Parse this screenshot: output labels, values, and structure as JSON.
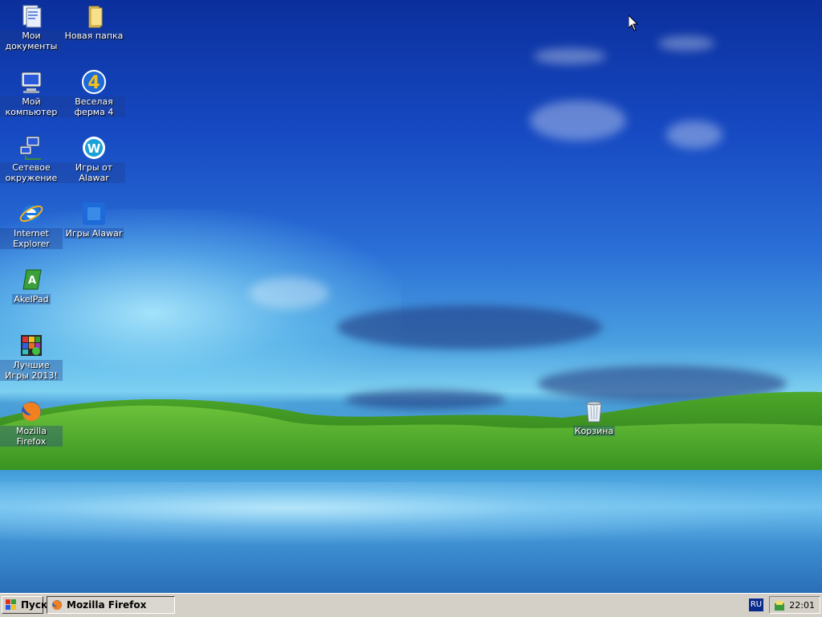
{
  "desktop": {
    "icons": [
      {
        "label": "Мои документы",
        "icon": "my-documents-icon"
      },
      {
        "label": "Новая папка",
        "icon": "folder-icon"
      },
      {
        "label": "Мой компьютер",
        "icon": "my-computer-icon"
      },
      {
        "label": "Веселая ферма 4",
        "icon": "farm-game-icon"
      },
      {
        "label": "Сетевое окружение",
        "icon": "network-icon"
      },
      {
        "label": "Игры от Alawar",
        "icon": "alawar-icon"
      },
      {
        "label": "Internet Explorer",
        "icon": "internet-explorer-icon"
      },
      {
        "label": "Игры Alawar",
        "icon": "alawar-games-icon"
      },
      {
        "label": "AkelPad",
        "icon": "akelpad-icon"
      },
      {
        "label": "Лучшие Игры 2013!",
        "icon": "best-games-icon"
      },
      {
        "label": "Mozilla Firefox",
        "icon": "firefox-icon"
      },
      {
        "label": "Корзина",
        "icon": "recycle-bin-icon"
      }
    ]
  },
  "taskbar": {
    "start_label": "Пуск",
    "tasks": [
      {
        "label": "Mozilla Firefox",
        "icon": "firefox-icon"
      }
    ],
    "language": "RU",
    "clock": "22:01"
  }
}
